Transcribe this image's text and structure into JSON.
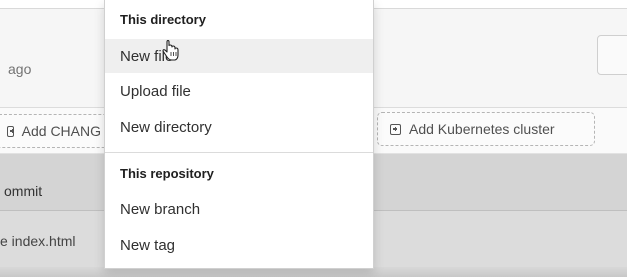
{
  "background": {
    "ago_text": "ago",
    "add_changes_label": "Add CHANG",
    "add_k8s_label": "Add Kubernetes cluster",
    "commit_text": "ommit",
    "index_text": "e index.html"
  },
  "dropdown": {
    "this_directory_header": "This directory",
    "items_directory": [
      "New file",
      "Upload file",
      "New directory"
    ],
    "this_repository_header": "This repository",
    "items_repository": [
      "New branch",
      "New tag"
    ]
  }
}
